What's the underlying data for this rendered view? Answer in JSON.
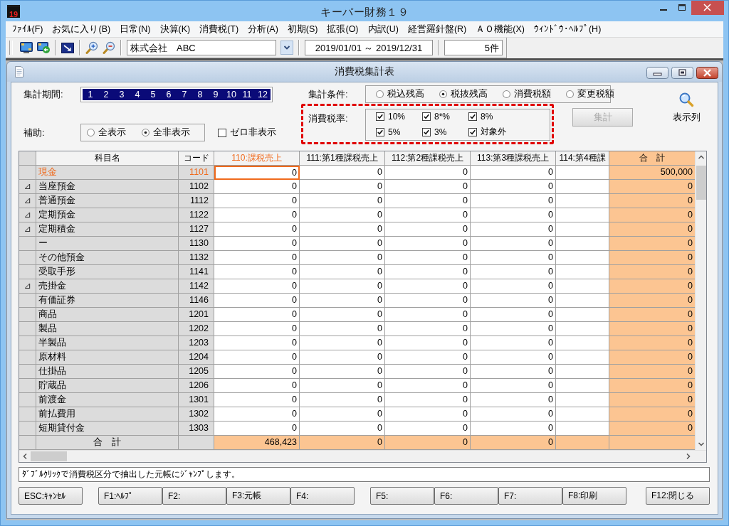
{
  "window": {
    "logo": "19",
    "title": "キーパー財務１９"
  },
  "menu": [
    "ﾌｧｲﾙ(F)",
    "お気に入り(B)",
    "日常(N)",
    "決算(K)",
    "消費税(T)",
    "分析(A)",
    "初期(S)",
    "拡張(O)",
    "内訳(U)",
    "経営羅針盤(R)",
    "ＡＯ機能(X)",
    "ｳｨﾝﾄﾞｳ･ﾍﾙﾌﾟ(H)"
  ],
  "toolbar": {
    "company": "株式会社　ABC",
    "period": "2019/01/01 ～ 2019/12/31",
    "count": "5件"
  },
  "child_window": {
    "title": "消費税集計表"
  },
  "period": {
    "label": "集計期間:",
    "months": [
      {
        "label": "1",
        "selected": true
      },
      {
        "label": "2",
        "selected": true
      },
      {
        "label": "3",
        "selected": true
      },
      {
        "label": "4",
        "selected": true
      },
      {
        "label": "5",
        "selected": true
      },
      {
        "label": "6",
        "selected": true
      },
      {
        "label": "7",
        "selected": true
      },
      {
        "label": "8",
        "selected": true
      },
      {
        "label": "9",
        "selected": true
      },
      {
        "label": "10",
        "selected": true
      },
      {
        "label": "11",
        "selected": true
      },
      {
        "label": "12",
        "selected": true
      }
    ]
  },
  "condition": {
    "label": "集計条件:",
    "options": [
      {
        "label": "税込残高",
        "selected": false
      },
      {
        "label": "税抜残高",
        "selected": true
      },
      {
        "label": "消費税額",
        "selected": false
      },
      {
        "label": "変更税額",
        "selected": false
      }
    ]
  },
  "tax_rate": {
    "label": "消費税率:",
    "highlighted": true,
    "options": [
      {
        "label": "10%",
        "checked": true
      },
      {
        "label": "8*%",
        "checked": true
      },
      {
        "label": "8%",
        "checked": true
      },
      {
        "label": "5%",
        "checked": true
      },
      {
        "label": "3%",
        "checked": true
      },
      {
        "label": "対象外",
        "checked": true
      }
    ]
  },
  "aggregate_button": {
    "label": "集計",
    "disabled": true
  },
  "column_picker": {
    "label": "表示列"
  },
  "auxiliary": {
    "label": "補助:",
    "options": [
      {
        "label": "全表示",
        "selected": false
      },
      {
        "label": "全非表示",
        "selected": true
      }
    ]
  },
  "zero_hide": {
    "label": "ゼロ非表示",
    "checked": false
  },
  "table": {
    "columns": [
      {
        "label": "科目名",
        "kind": "name",
        "selected": false
      },
      {
        "label": "コード",
        "kind": "code",
        "selected": false
      },
      {
        "label": "110:課税売上",
        "kind": "value",
        "selected": true
      },
      {
        "label": "111:第1種課税売上",
        "kind": "value",
        "selected": false
      },
      {
        "label": "112:第2種課税売上",
        "kind": "value",
        "selected": false
      },
      {
        "label": "113:第3種課税売上",
        "kind": "value",
        "selected": false
      },
      {
        "label": "114:第4種課",
        "kind": "value",
        "selected": false
      },
      {
        "label": "合　計",
        "kind": "total",
        "selected": false
      }
    ],
    "rows": [
      {
        "name": "現金",
        "code": "1101",
        "values": [
          "0",
          "0",
          "0",
          "0"
        ],
        "total": "500,000",
        "selected": true
      },
      {
        "marker": "⊿",
        "name": "当座預金",
        "code": "1102",
        "values": [
          "0",
          "0",
          "0",
          "0"
        ],
        "total": "0",
        "selected": false
      },
      {
        "marker": "⊿",
        "name": "普通預金",
        "code": "1112",
        "values": [
          "0",
          "0",
          "0",
          "0"
        ],
        "total": "0",
        "selected": false
      },
      {
        "marker": "⊿",
        "name": "定期預金",
        "code": "1122",
        "values": [
          "0",
          "0",
          "0",
          "0"
        ],
        "total": "0",
        "selected": false
      },
      {
        "marker": "⊿",
        "name": "定期積金",
        "code": "1127",
        "values": [
          "0",
          "0",
          "0",
          "0"
        ],
        "total": "0",
        "selected": false
      },
      {
        "name": "ー",
        "code": "1130",
        "values": [
          "0",
          "0",
          "0",
          "0"
        ],
        "total": "0",
        "selected": false
      },
      {
        "name": "その他預金",
        "code": "1132",
        "values": [
          "0",
          "0",
          "0",
          "0"
        ],
        "total": "0",
        "selected": false
      },
      {
        "name": "受取手形",
        "code": "1141",
        "values": [
          "0",
          "0",
          "0",
          "0"
        ],
        "total": "0",
        "selected": false
      },
      {
        "marker": "⊿",
        "name": "売掛金",
        "code": "1142",
        "values": [
          "0",
          "0",
          "0",
          "0"
        ],
        "total": "0",
        "selected": false
      },
      {
        "name": "有価証券",
        "code": "1146",
        "values": [
          "0",
          "0",
          "0",
          "0"
        ],
        "total": "0",
        "selected": false
      },
      {
        "name": "商品",
        "code": "1201",
        "values": [
          "0",
          "0",
          "0",
          "0"
        ],
        "total": "0",
        "selected": false
      },
      {
        "name": "製品",
        "code": "1202",
        "values": [
          "0",
          "0",
          "0",
          "0"
        ],
        "total": "0",
        "selected": false
      },
      {
        "name": "半製品",
        "code": "1203",
        "values": [
          "0",
          "0",
          "0",
          "0"
        ],
        "total": "0",
        "selected": false
      },
      {
        "name": "原材料",
        "code": "1204",
        "values": [
          "0",
          "0",
          "0",
          "0"
        ],
        "total": "0",
        "selected": false
      },
      {
        "name": "仕掛品",
        "code": "1205",
        "values": [
          "0",
          "0",
          "0",
          "0"
        ],
        "total": "0",
        "selected": false
      },
      {
        "name": "貯蔵品",
        "code": "1206",
        "values": [
          "0",
          "0",
          "0",
          "0"
        ],
        "total": "0",
        "selected": false
      },
      {
        "name": "前渡金",
        "code": "1301",
        "values": [
          "0",
          "0",
          "0",
          "0"
        ],
        "total": "0",
        "selected": false
      },
      {
        "name": "前払費用",
        "code": "1302",
        "values": [
          "0",
          "0",
          "0",
          "0"
        ],
        "total": "0",
        "selected": false
      },
      {
        "name": "短期貸付金",
        "code": "1303",
        "values": [
          "0",
          "0",
          "0",
          "0"
        ],
        "total": "0",
        "selected": false
      }
    ],
    "total_row": {
      "label": "合　計",
      "values": [
        "468,423",
        "0",
        "0",
        "0"
      ]
    }
  },
  "status_message": "ﾀﾞﾌﾞﾙｸﾘｯｸで消費税区分で抽出した元帳にｼﾞｬﾝﾌﾟします。",
  "function_keys": [
    [
      "ESC:ｷｬﾝｾﾙ"
    ],
    [
      "F1:ﾍﾙﾌﾟ",
      "F2:",
      "F3:元帳",
      "F4:"
    ],
    [
      "F5:",
      "F6:",
      "F7:",
      "F8:印刷"
    ],
    [
      "F12:閉じる"
    ]
  ]
}
